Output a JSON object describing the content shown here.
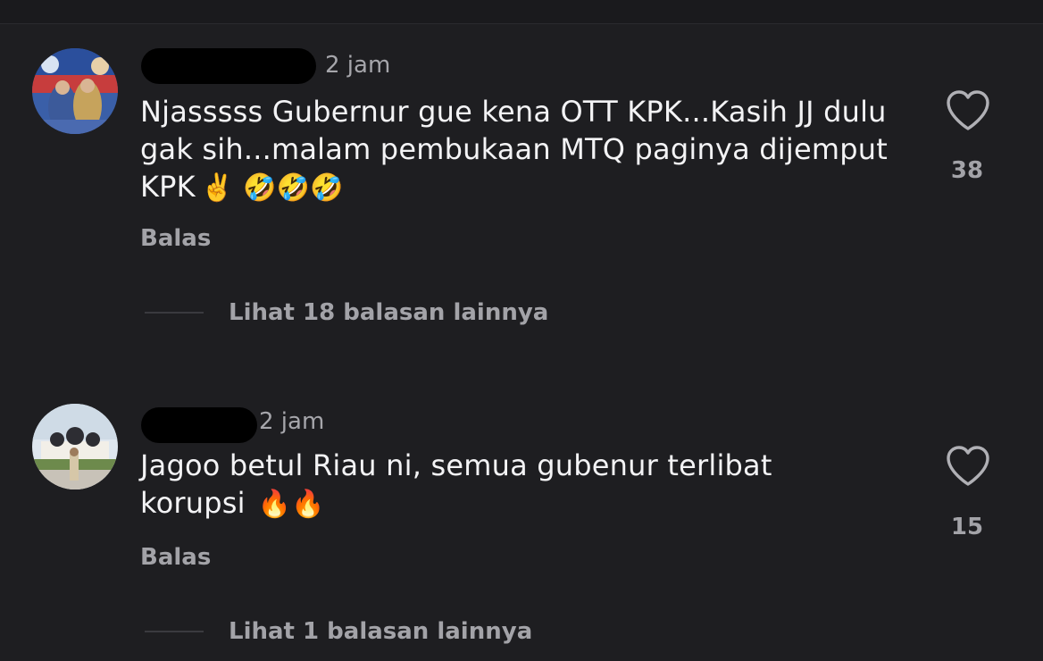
{
  "comments": [
    {
      "timestamp": "2 jam",
      "text": "Njasssss Gubernur gue kena OTT KPK...Kasih JJ dulu gak sih...malam pembukaan MTQ paginya dijemput KPK",
      "emojis": "✌️ 🤣🤣🤣",
      "reply_label": "Balas",
      "like_count": "38",
      "more_replies_label": "Lihat 18 balasan lainnya",
      "avatar_icon": "wedding-photo-avatar"
    },
    {
      "timestamp": "2 jam",
      "text": "Jagoo betul Riau ni, semua gubenur terlibat korupsi",
      "emojis": "🔥🔥",
      "reply_label": "Balas",
      "like_count": "15",
      "more_replies_label": "Lihat 1 balasan lainnya",
      "avatar_icon": "mosque-photo-avatar"
    }
  ],
  "icons": {
    "like": "heart-outline-icon"
  },
  "colors": {
    "background": "#1e1e21",
    "text_primary": "#f3f3f5",
    "text_secondary": "#a3a3a8"
  }
}
